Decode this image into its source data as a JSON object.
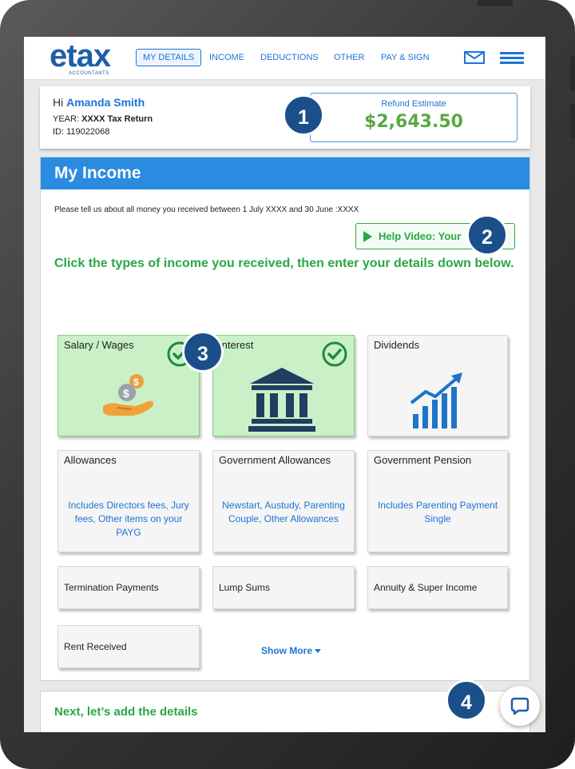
{
  "nav": {
    "logo_text": "etax",
    "logo_sub": "ACCOUNTANTS",
    "items": [
      "MY DETAILS",
      "INCOME",
      "DEDUCTIONS",
      "OTHER",
      "PAY & SIGN"
    ],
    "active_item": "MY DETAILS",
    "icons": [
      "mail-icon",
      "menu-icon"
    ]
  },
  "profile": {
    "greeting": "Hi",
    "name": "Amanda Smith",
    "year_label": "YEAR:",
    "year_value": "XXXX Tax Return",
    "id_line": "ID: 119022068",
    "refund_label": "Refund Estimate",
    "refund_value": "$2,643.50"
  },
  "income": {
    "title": "My Income",
    "intro": "Please tell us about all money you received between 1 July XXXX  and 30 June :XXXX",
    "help_button": "Help Video: Your",
    "instruction": "Click the types of income you received, then enter your details down below.",
    "tiles": [
      {
        "title": "Salary / Wages",
        "selected": true,
        "icon": "money-hand-icon"
      },
      {
        "title": "Interest",
        "selected": true,
        "icon": "bank-icon"
      },
      {
        "title": "Dividends",
        "selected": false,
        "icon": "growth-chart-icon"
      },
      {
        "title": "Allowances",
        "desc": "Includes Directors fees, Jury fees, Other items on your PAYG"
      },
      {
        "title": "Government Allowances",
        "desc": "Newstart, Austudy, Parenting Couple, Other Allowances"
      },
      {
        "title": "Government Pension",
        "desc": "Includes Parenting Payment Single"
      },
      {
        "title": "Termination Payments"
      },
      {
        "title": "Lump Sums"
      },
      {
        "title": "Annuity & Super Income"
      },
      {
        "title": "Rent Received"
      }
    ],
    "show_more": "Show More"
  },
  "next": {
    "title": "Next, let’s add the details"
  },
  "callouts": [
    "1",
    "2",
    "3",
    "4"
  ],
  "colors": {
    "brand_blue": "#1e5fa8",
    "link_blue": "#1e73d6",
    "header_blue": "#2b8be0",
    "green": "#28a745",
    "selected_tile": "#c9f0c6",
    "callout": "#1b4f8a"
  }
}
